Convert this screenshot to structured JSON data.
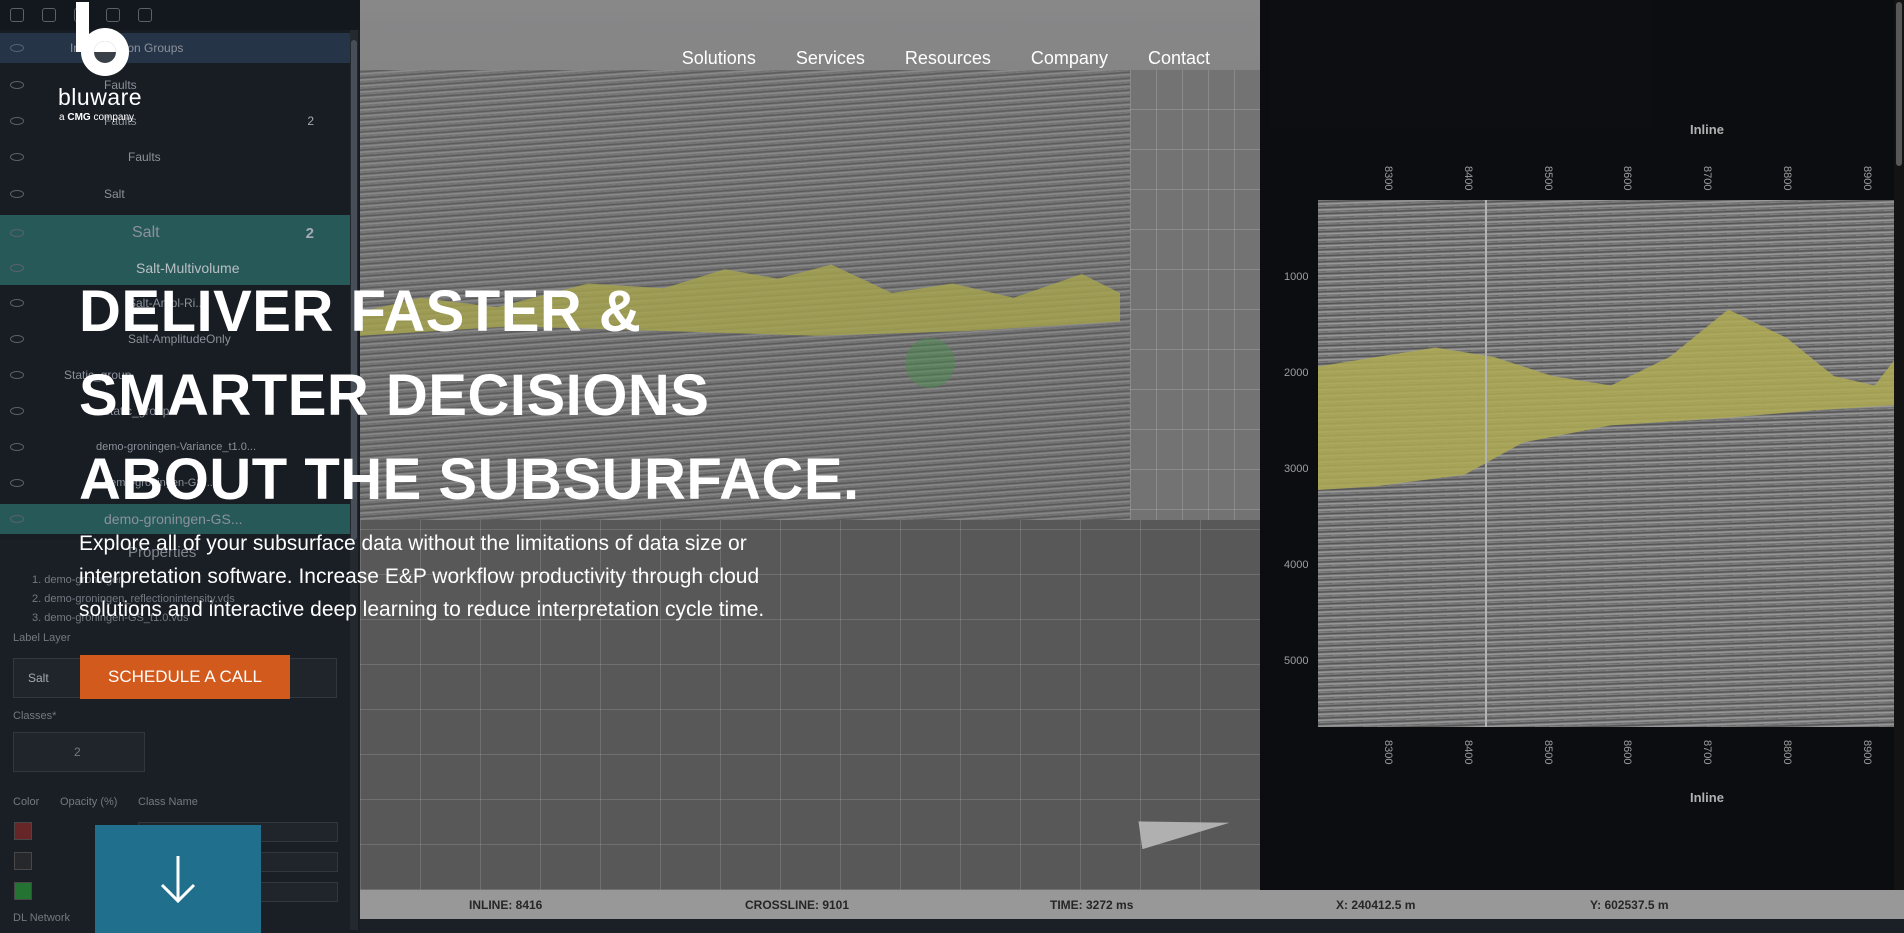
{
  "brand": {
    "name": "bluware",
    "tagline_prefix": "a",
    "tagline_brand": "CMG",
    "tagline_suffix": "company"
  },
  "nav": {
    "items": [
      {
        "label": "Solutions"
      },
      {
        "label": "Services"
      },
      {
        "label": "Resources"
      },
      {
        "label": "Company"
      },
      {
        "label": "Contact"
      }
    ]
  },
  "hero": {
    "title_lines": [
      "DELIVER FASTER &",
      "SMARTER DECISIONS",
      "ABOUT THE SUBSURFACE."
    ],
    "copy": "Explore all of your subsurface data without the limitations of data size or interpretation software. Increase E&P workflow productivity through cloud solutions and interactive deep learning to reduce interpretation cycle time.",
    "cta_label": "SCHEDULE A CALL",
    "scroll_icon": "arrow-down-icon"
  },
  "app_mock": {
    "tree": [
      {
        "label": "Interpretation Groups"
      },
      {
        "label": "Faults"
      },
      {
        "label": "Faults",
        "count": "2"
      },
      {
        "label": "Faults"
      },
      {
        "label": "Salt"
      },
      {
        "label": "Salt",
        "count": "2"
      },
      {
        "label": "Salt-Multivolume"
      },
      {
        "label": "Salt-Ampl-Ri..."
      },
      {
        "label": "Salt-AmplitudeOnly"
      },
      {
        "label": "Static_group"
      },
      {
        "label": "static_group"
      },
      {
        "label": "demo-groningen-Variance_t1.0..."
      },
      {
        "label": "demo-groningen-GS..."
      },
      {
        "label": "demo-groningen-GS..."
      }
    ],
    "properties_title": "Properties",
    "property_files": [
      "1. demo-groningen...",
      "2. demo-groningen_reflectionintensity.vds",
      "3. demo-groningen-GS_t1.0.vds"
    ],
    "label_layer": "Label Layer",
    "label_layer_value": "Salt",
    "classes_label": "Classes*",
    "classes_value": "2",
    "color_label": "Color",
    "opacity_label": "Opacity (%)",
    "class_name_label": "Class Name",
    "dl_network": "DL Network",
    "colors": [
      "#7a2d2d",
      "#2c2f33",
      "#2a8a3a"
    ],
    "section_title_top": "Inline",
    "section_title_bottom": "Inline",
    "x_ticks": [
      "8300",
      "8400",
      "8500",
      "8600",
      "8700",
      "8800",
      "8900"
    ],
    "y_ticks": [
      "1000",
      "2000",
      "3000",
      "4000",
      "5000"
    ],
    "status": {
      "inline": "INLINE: 8416",
      "crossline": "CROSSLINE: 9101",
      "time": "TIME: 3272 ms",
      "x": "X: 240412.5 m",
      "y": "Y: 602537.5 m"
    }
  },
  "colors": {
    "cta": "#d35a1d",
    "scroll_button": "#1f6f8d",
    "salt_highlight": "#c9c75a"
  }
}
